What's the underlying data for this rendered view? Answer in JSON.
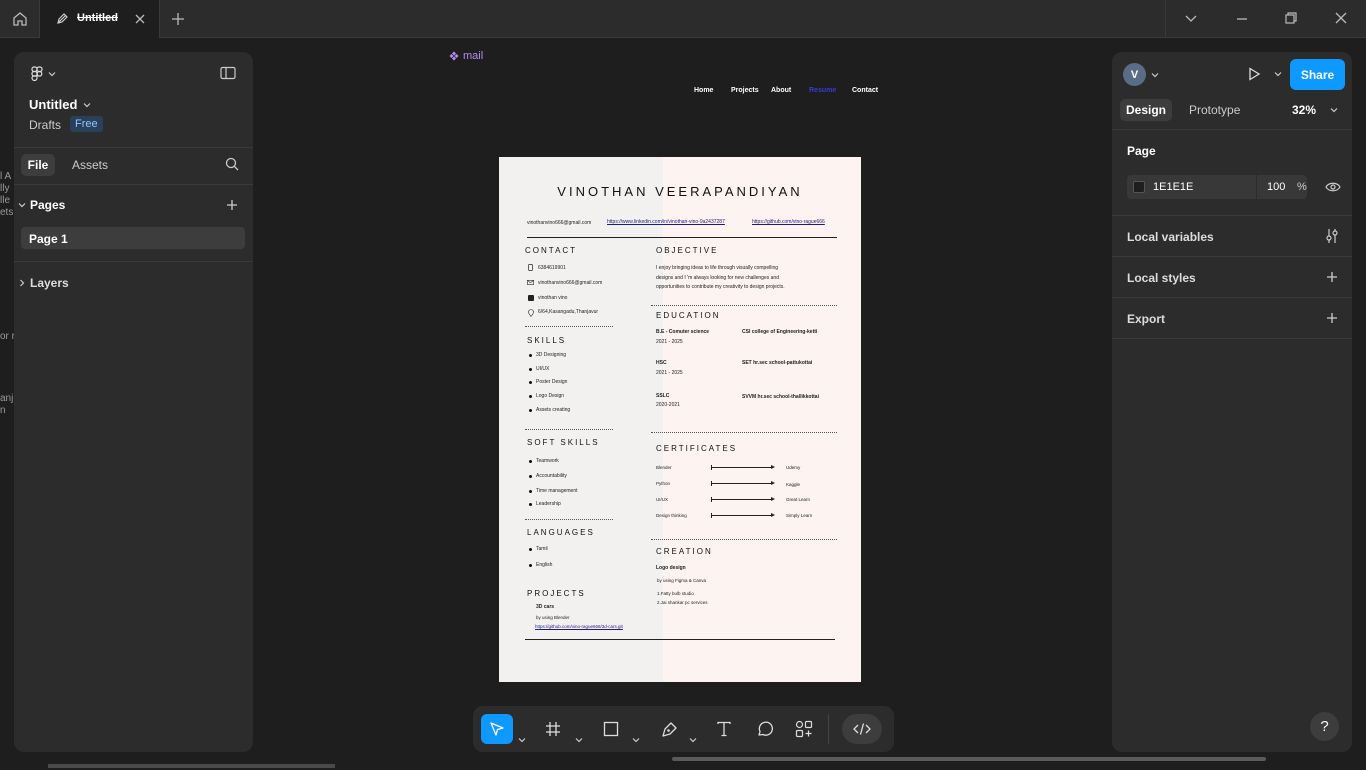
{
  "tabs": {
    "file_title": "Untitled"
  },
  "canvas_edge_text": [
    "l A",
    "lly",
    "lle",
    "ets",
    "or r",
    "anj",
    "n"
  ],
  "left_panel": {
    "file_name": "Untitled",
    "location": "Drafts",
    "plan_badge": "Free",
    "tab_file": "File",
    "tab_assets": "Assets",
    "pages_heading": "Pages",
    "page_item": "Page 1",
    "layers_heading": "Layers"
  },
  "frame": {
    "label": "mail",
    "nav": [
      "Home",
      "Projects",
      "About",
      "Resume",
      "Contact"
    ],
    "nav_active_color": "#3a3ad0"
  },
  "resume": {
    "name": "VINOTHAN VEERAPANDIYAN",
    "email": "vinothanvino666@gmail.com",
    "linkedin": "https://www.linkedin.com/in/vinothan-vino-9a2437287",
    "github": "https://github.com/vino-rague666",
    "contact_heading": "CONTACT",
    "phone": "6384619901",
    "contact_email": "vinothanvino666@gmail.com",
    "linkedin_name": "vinothan vino",
    "address": "6/64,Kasangadu,Thanjavur",
    "skills_heading": "SKILLS",
    "skills": [
      "3D Designing",
      "UI/UX",
      "Poster Design",
      "Logo Design",
      "Assets creating"
    ],
    "soft_skills_heading": "SOFT SKILLS",
    "soft_skills": [
      "Teamwork",
      "Accountability",
      "Time management",
      "Leadership"
    ],
    "languages_heading": "LANGUAGES",
    "languages": [
      "Tamil",
      "English"
    ],
    "projects_heading": "PROJECTS",
    "project_title": "3D cars",
    "project_sub": "by using Blender",
    "project_link": "https://github.com/vino-rague666/3d-cars.git",
    "objective_heading": "OBJECTIVE",
    "objective_lines": [
      "I enjoy bringing ideas to life through visually compelling",
      "designs and I 'm  always looking for new challenges and",
      "opportunities to contribute my creativity to design projects."
    ],
    "education_heading": "EDUCATION",
    "education": [
      {
        "degree": "B.E - Comuter science",
        "years": "2021 - 2025",
        "school": "CSI college of  Engineering-ketti"
      },
      {
        "degree": "HSC",
        "years": "2021 - 2025",
        "school": "SET hr.sec school-pattukottai"
      },
      {
        "degree": "SSLC",
        "years": "2020-2021",
        "school": "SVVM hr.sec school-thallikkottai"
      }
    ],
    "certificates_heading": "CERTIFICATES",
    "certificates": [
      {
        "name": "Blender",
        "issuer": "Udemy"
      },
      {
        "name": "Python",
        "issuer": "Kaggle"
      },
      {
        "name": "UI/UX",
        "issuer": "Great Learn"
      },
      {
        "name": "Design thinking",
        "issuer": "Simply Learn"
      }
    ],
    "creation_heading": "CREATION",
    "creation_title": "Logo design",
    "creation_sub": "by using Figma & Canva",
    "creation_items": [
      "1.Fatty bulb studio",
      "2.Jai shankar pc services"
    ]
  },
  "right_panel": {
    "avatar_letter": "V",
    "share_label": "Share",
    "tab_design": "Design",
    "tab_prototype": "Prototype",
    "zoom": "32%",
    "page_heading": "Page",
    "bg_hex": "1E1E1E",
    "bg_opacity": "100",
    "percent_sign": "%",
    "local_variables": "Local variables",
    "local_styles": "Local styles",
    "export": "Export"
  },
  "help_label": "?",
  "colors": {
    "accent": "#0d99ff",
    "frame_label": "#b88cf5",
    "page_swatch": "#1e1e1e"
  }
}
